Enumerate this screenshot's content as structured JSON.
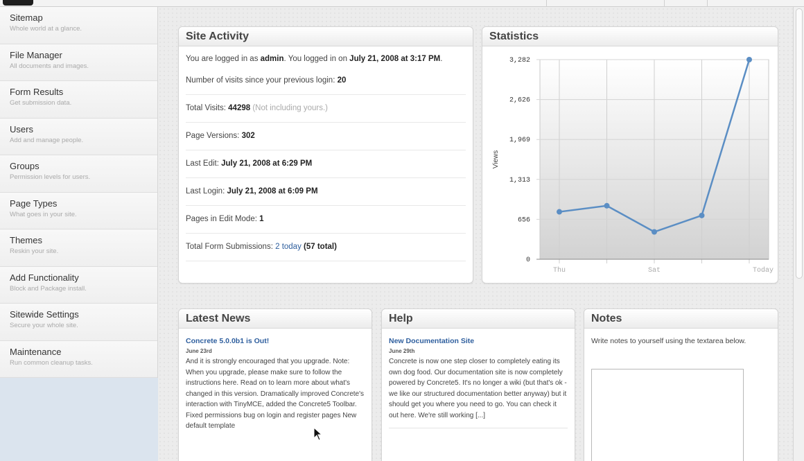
{
  "sidebar": {
    "items": [
      {
        "title": "Sitemap",
        "desc": "Whole world at a glance."
      },
      {
        "title": "File Manager",
        "desc": "All documents and images."
      },
      {
        "title": "Form Results",
        "desc": "Get submission data."
      },
      {
        "title": "Users",
        "desc": "Add and manage people."
      },
      {
        "title": "Groups",
        "desc": "Permission levels for users."
      },
      {
        "title": "Page Types",
        "desc": "What goes in your site."
      },
      {
        "title": "Themes",
        "desc": "Reskin your site."
      },
      {
        "title": "Add Functionality",
        "desc": "Block and Package install."
      },
      {
        "title": "Sitewide Settings",
        "desc": "Secure your whole site."
      },
      {
        "title": "Maintenance",
        "desc": "Run common cleanup tasks."
      }
    ]
  },
  "activity": {
    "title": "Site Activity",
    "login_pre": "You are logged in as ",
    "login_user": "admin",
    "login_mid": ". You logged in on ",
    "login_date": "July 21, 2008 at 3:17 PM",
    "login_end": ".",
    "visits_label": "Number of visits since your previous login: ",
    "visits_value": "20",
    "total_label": "Total Visits: ",
    "total_value": "44298",
    "total_note": " (Not including yours.)",
    "versions_label": "Page Versions: ",
    "versions_value": "302",
    "edit_label": "Last Edit: ",
    "edit_value": "July 21, 2008 at 6:29 PM",
    "lastlogin_label": "Last Login: ",
    "lastlogin_value": "July 21, 2008 at 6:09 PM",
    "editmode_label": "Pages in Edit Mode: ",
    "editmode_value": "1",
    "forms_label": "Total Form Submissions: ",
    "forms_today": "2 today",
    "forms_total": " (57 total)"
  },
  "statistics": {
    "title": "Statistics"
  },
  "chart_data": {
    "type": "line",
    "categories": [
      "Thu",
      "",
      "Sat",
      "",
      "Today"
    ],
    "tick_labels": [
      "Thu",
      "Sat",
      "Today"
    ],
    "values": [
      780,
      880,
      450,
      720,
      3282
    ],
    "ylabel": "Views",
    "yticks": [
      "0",
      "656",
      "1,313",
      "1,969",
      "2,626",
      "3,282"
    ],
    "ylim": [
      0,
      3282
    ],
    "grid": true,
    "color": "#5b8ec4"
  },
  "news": {
    "title": "Latest News",
    "item_title": "Concrete 5.0.0b1 is Out!",
    "item_date": "June 23rd",
    "item_text": "And it is strongly encouraged that you upgrade. Note: When you upgrade, please make sure to follow the instructions here. Read on to learn more about what's changed in this version. Dramatically improved Concrete's interaction with TinyMCE, added the Concrete5 Toolbar. Fixed permissions bug on login and register pages New default template"
  },
  "help": {
    "title": "Help",
    "item_title": "New Documentation Site",
    "item_date": "June 29th",
    "item_text": "Concrete is now one step closer to completely eating its own dog food. Our documentation site is now completely powered by Concrete5. It's no longer a wiki (but that's ok - we like our structured documentation better anyway) but it should get you where you need to go. You can check it out here. We're still working [...]"
  },
  "notes": {
    "title": "Notes",
    "text": "Write notes to yourself using the textarea below."
  }
}
